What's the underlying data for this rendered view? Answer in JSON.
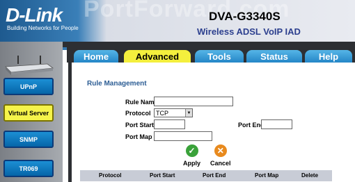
{
  "header": {
    "watermark": "PortForward.com",
    "brand": "D-Link",
    "tagline": "Building Networks for People",
    "model": "DVA-G3340S",
    "subtitle": "Wireless ADSL VoIP IAD"
  },
  "sidebar": {
    "items": [
      {
        "label": "UPnP"
      },
      {
        "label": "Virtual Server"
      },
      {
        "label": "SNMP"
      },
      {
        "label": "TR069"
      }
    ]
  },
  "tabs": [
    {
      "label": "Home"
    },
    {
      "label": "Advanced"
    },
    {
      "label": "Tools"
    },
    {
      "label": "Status"
    },
    {
      "label": "Help"
    }
  ],
  "form": {
    "title": "Rule Management",
    "rule_name_label": "Rule Name",
    "rule_name_value": "",
    "protocol_label": "Protocol",
    "protocol_value": "TCP",
    "port_start_label": "Port Start",
    "port_start_value": "",
    "port_end_label": "Port End",
    "port_end_value": "",
    "port_map_label": "Port Map",
    "port_map_value": ""
  },
  "actions": {
    "apply": "Apply",
    "cancel": "Cancel"
  },
  "table": {
    "columns": [
      "Protocol",
      "Port Start",
      "Port End",
      "Port Map",
      "Delete"
    ]
  },
  "colors": {
    "tab_active": "#f4ef3d",
    "tab_inactive": "#2486c7",
    "sidebar_active": "#f5f34a",
    "section_title": "#2c5d94"
  }
}
